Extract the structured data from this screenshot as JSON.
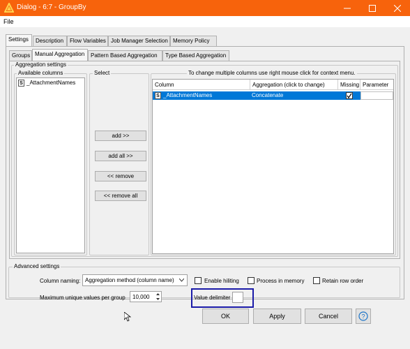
{
  "window": {
    "title": "Dialog - 6:7 - GroupBy",
    "minimize_icon": "minimize-icon",
    "maximize_icon": "maximize-icon",
    "close_icon": "close-icon",
    "titlebar_color": "#f7630c"
  },
  "menu": {
    "file": "File"
  },
  "outer_tabs": [
    "Settings",
    "Description",
    "Flow Variables",
    "Job Manager Selection",
    "Memory Policy"
  ],
  "inner_tabs": [
    "Groups",
    "Manual Aggregation",
    "Pattern Based Aggregation",
    "Type Based Aggregation"
  ],
  "aggregation": {
    "legend": "Aggregation settings",
    "available_legend": "Available columns",
    "available_columns": [
      {
        "type": "S",
        "name": "_AttachmentNames"
      }
    ],
    "select_legend": "Select",
    "buttons": {
      "add": "add >>",
      "add_all": "add all >>",
      "remove": "<< remove",
      "remove_all": "<< remove all"
    },
    "table_legend": "To change multiple columns use right mouse click for context menu.",
    "headers": [
      "Column",
      "Aggregation (click to change)",
      "Missing",
      "Parameter"
    ],
    "rows": [
      {
        "type": "S",
        "column": "_AttachmentNames",
        "aggregation": "Concatenate",
        "missing": true,
        "parameter": ""
      }
    ],
    "selected_row_color": "#0078d7"
  },
  "advanced": {
    "legend": "Advanced settings",
    "column_naming_label": "Column naming:",
    "column_naming_value": "Aggregation method (column name)",
    "enable_hiliting": "Enable hiliting",
    "process_in_memory": "Process in memory",
    "retain_row_order": "Retain row order",
    "max_unique_label": "Maximum unique values per group",
    "max_unique_value": "10,000",
    "value_delimiter_label": "Value delimiter",
    "value_delimiter_value": "",
    "highlight_color": "#1a1aa8"
  },
  "footer": {
    "ok": "OK",
    "apply": "Apply",
    "cancel": "Cancel",
    "help_icon": "help-icon"
  }
}
